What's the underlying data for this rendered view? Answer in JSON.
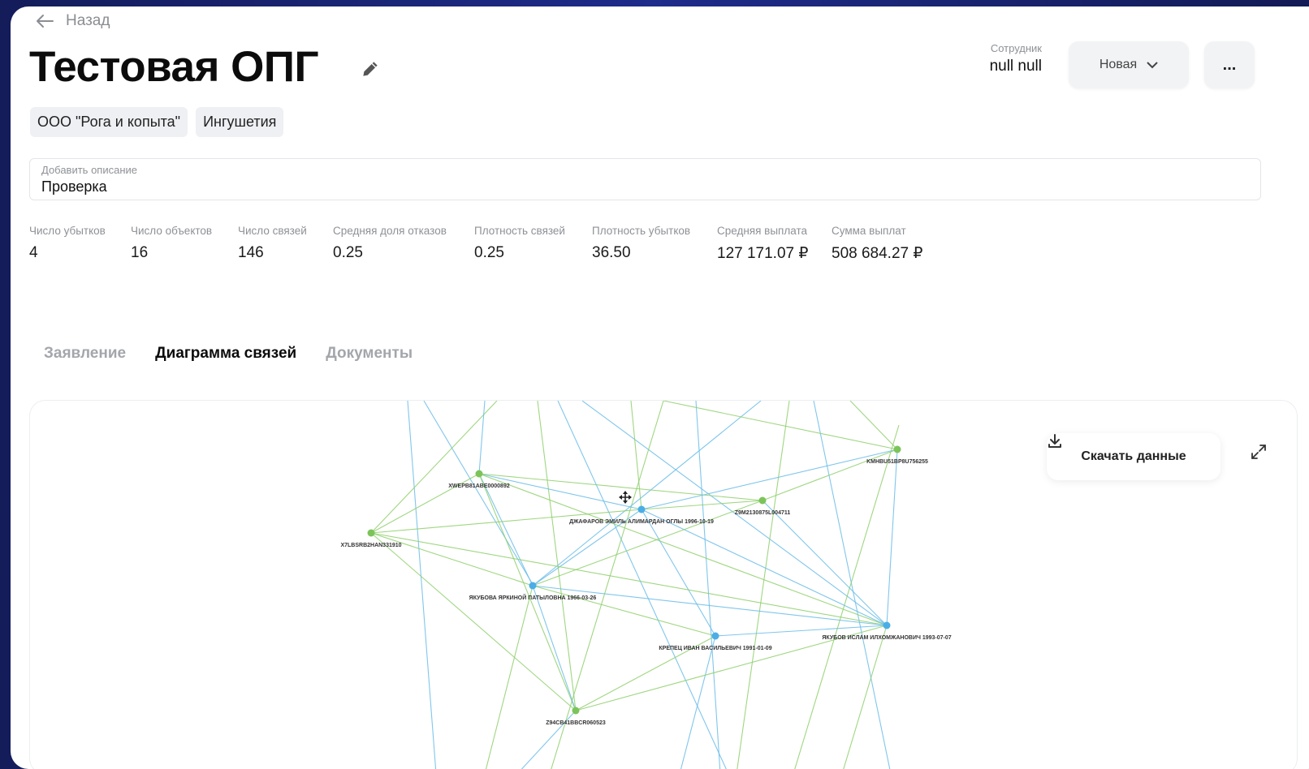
{
  "nav": {
    "back_label": "Назад"
  },
  "header": {
    "title": "Тестовая ОПГ",
    "tags": [
      "ООО \"Рога и копыта\"",
      "Ингушетия"
    ],
    "employee_label": "Сотрудник",
    "employee_value": "null null",
    "status_label": "Новая",
    "more_label": "..."
  },
  "description": {
    "placeholder": "Добавить описание",
    "value": "Проверка"
  },
  "stats": [
    {
      "label": "Число убытков",
      "value": "4"
    },
    {
      "label": "Число объектов",
      "value": "16"
    },
    {
      "label": "Число связей",
      "value": "146"
    },
    {
      "label": "Средняя доля отказов",
      "value": "0.25"
    },
    {
      "label": "Плотность связей",
      "value": "0.25"
    },
    {
      "label": "Плотность убытков",
      "value": "36.50"
    },
    {
      "label": "Средняя выплата",
      "value": "127 171.07 ₽"
    },
    {
      "label": "Сумма выплат",
      "value": "508 684.27 ₽"
    }
  ],
  "tabs": [
    {
      "label": "Заявление",
      "active": false
    },
    {
      "label": "Диаграмма связей",
      "active": true
    },
    {
      "label": "Документы",
      "active": false
    }
  ],
  "graph": {
    "download_label": "Скачать данные",
    "colors": {
      "green": "#7cc45a",
      "blue": "#4aaee6",
      "green_edge": "#8fd06c",
      "blue_edge": "#6bbde8"
    },
    "nodes": [
      {
        "id": "n1",
        "label": "XWEPB81ABE0000892",
        "type": "green"
      },
      {
        "id": "n2",
        "label": "KMHBU51BP8U756255",
        "type": "green"
      },
      {
        "id": "n3",
        "label": "ДЖАФАРОВ ЭМИЛЬ АЛИМАРДАН ОГЛЫ 1996-10-19",
        "type": "blue"
      },
      {
        "id": "n4",
        "label": "Z9M2130875L004711",
        "type": "green"
      },
      {
        "id": "n5",
        "label": "X7LBSRB2HAN331910",
        "type": "green"
      },
      {
        "id": "n6",
        "label": "ЯКУБОВА ЯРКИНОЙ ПАТЫЛОВНА 1966-03-26",
        "type": "blue"
      },
      {
        "id": "n7",
        "label": "КРЕПЕЦ ИВАН ВАСИЛЬЕВИЧ 1991-01-09",
        "type": "blue"
      },
      {
        "id": "n8",
        "label": "ЯКУБОВ ИСЛАМ ИЛХОМЖАНОВИЧ 1993-07-07",
        "type": "blue"
      },
      {
        "id": "n9",
        "label": "Z94CB41BBCR060523",
        "type": "green"
      }
    ]
  }
}
